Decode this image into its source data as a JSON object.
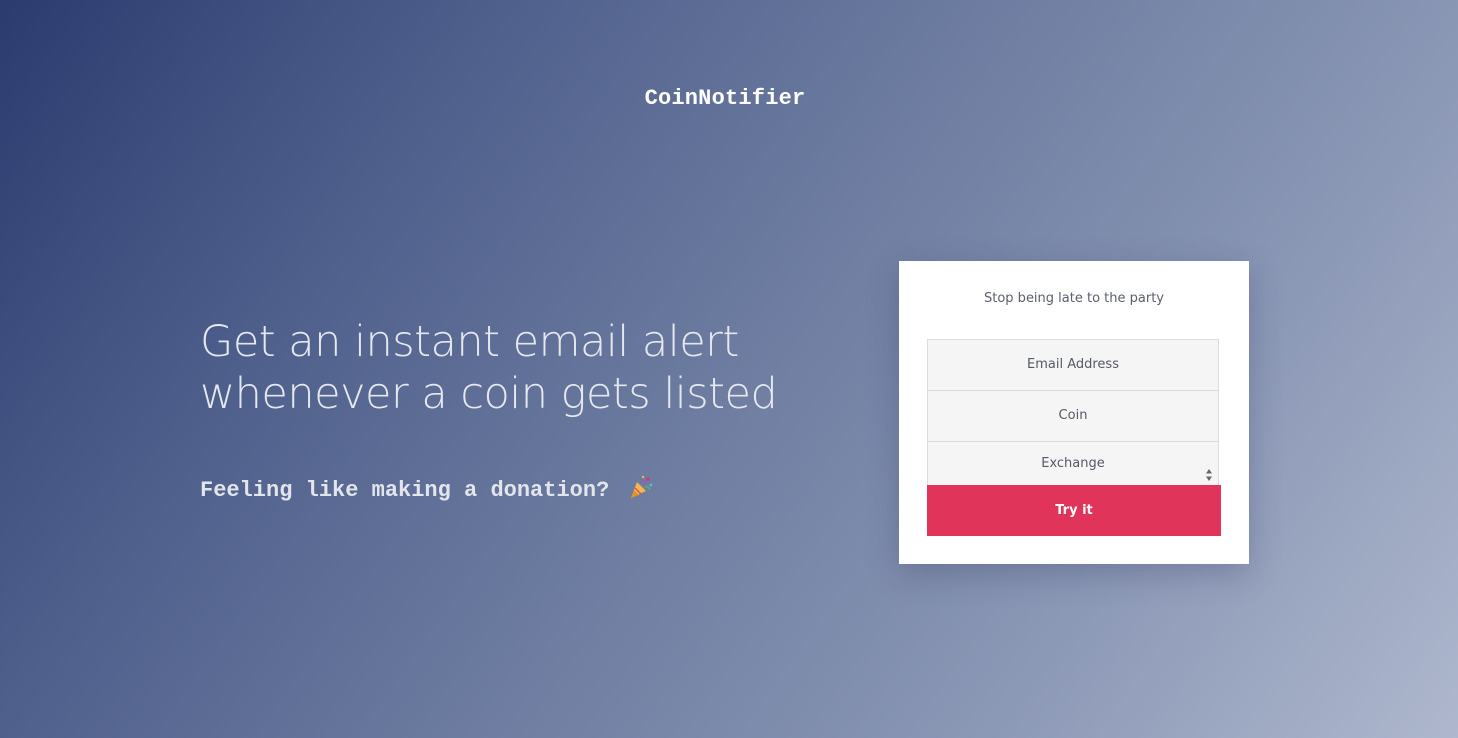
{
  "header": {
    "brand": "CoinNotifier"
  },
  "hero": {
    "headline_line1": "Get an instant email alert",
    "headline_line2": "whenever a coin gets listed",
    "donation_text": "Feeling like making a donation?",
    "donation_icon": "party-popper-icon"
  },
  "signup_card": {
    "tagline": "Stop being late to the party",
    "email_placeholder": "Email Address",
    "coin_placeholder": "Coin",
    "exchange_selected": "Exchange",
    "submit_label": "Try it"
  },
  "colors": {
    "button": "#e0345a",
    "gradient_start": "#2c3b6e",
    "gradient_end": "#aeb7cd"
  }
}
